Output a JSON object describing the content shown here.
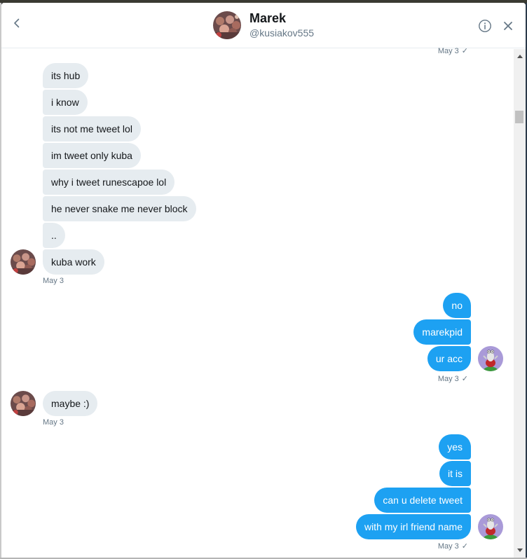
{
  "header": {
    "name": "Marek",
    "handle": "@kusiakov555"
  },
  "timestamps": {
    "top": "May 3",
    "marek_1": "May 3",
    "me_1": "May 3",
    "marek_2": "May 3",
    "me_2": "May 3"
  },
  "messages": {
    "marek_group_1": [
      "its hub",
      "i know",
      "its not me tweet lol",
      "im tweet only kuba",
      "why i tweet runescapoe lol",
      "he never snake me never block",
      "..",
      "kuba work"
    ],
    "me_group_1": [
      "no",
      "marekpid",
      "ur acc"
    ],
    "marek_group_2": [
      "maybe :)"
    ],
    "me_group_2": [
      "yes",
      "it is",
      "can u delete tweet",
      "with my irl friend name"
    ]
  },
  "icons": {
    "back": "chevron-left-icon",
    "info": "info-icon",
    "close": "close-icon",
    "read": "checkmark-icon"
  },
  "colors": {
    "outgoing_bubble": "#1da1f2",
    "incoming_bubble": "#e6ecf0",
    "text_primary": "#14171a",
    "text_secondary": "#657786"
  }
}
